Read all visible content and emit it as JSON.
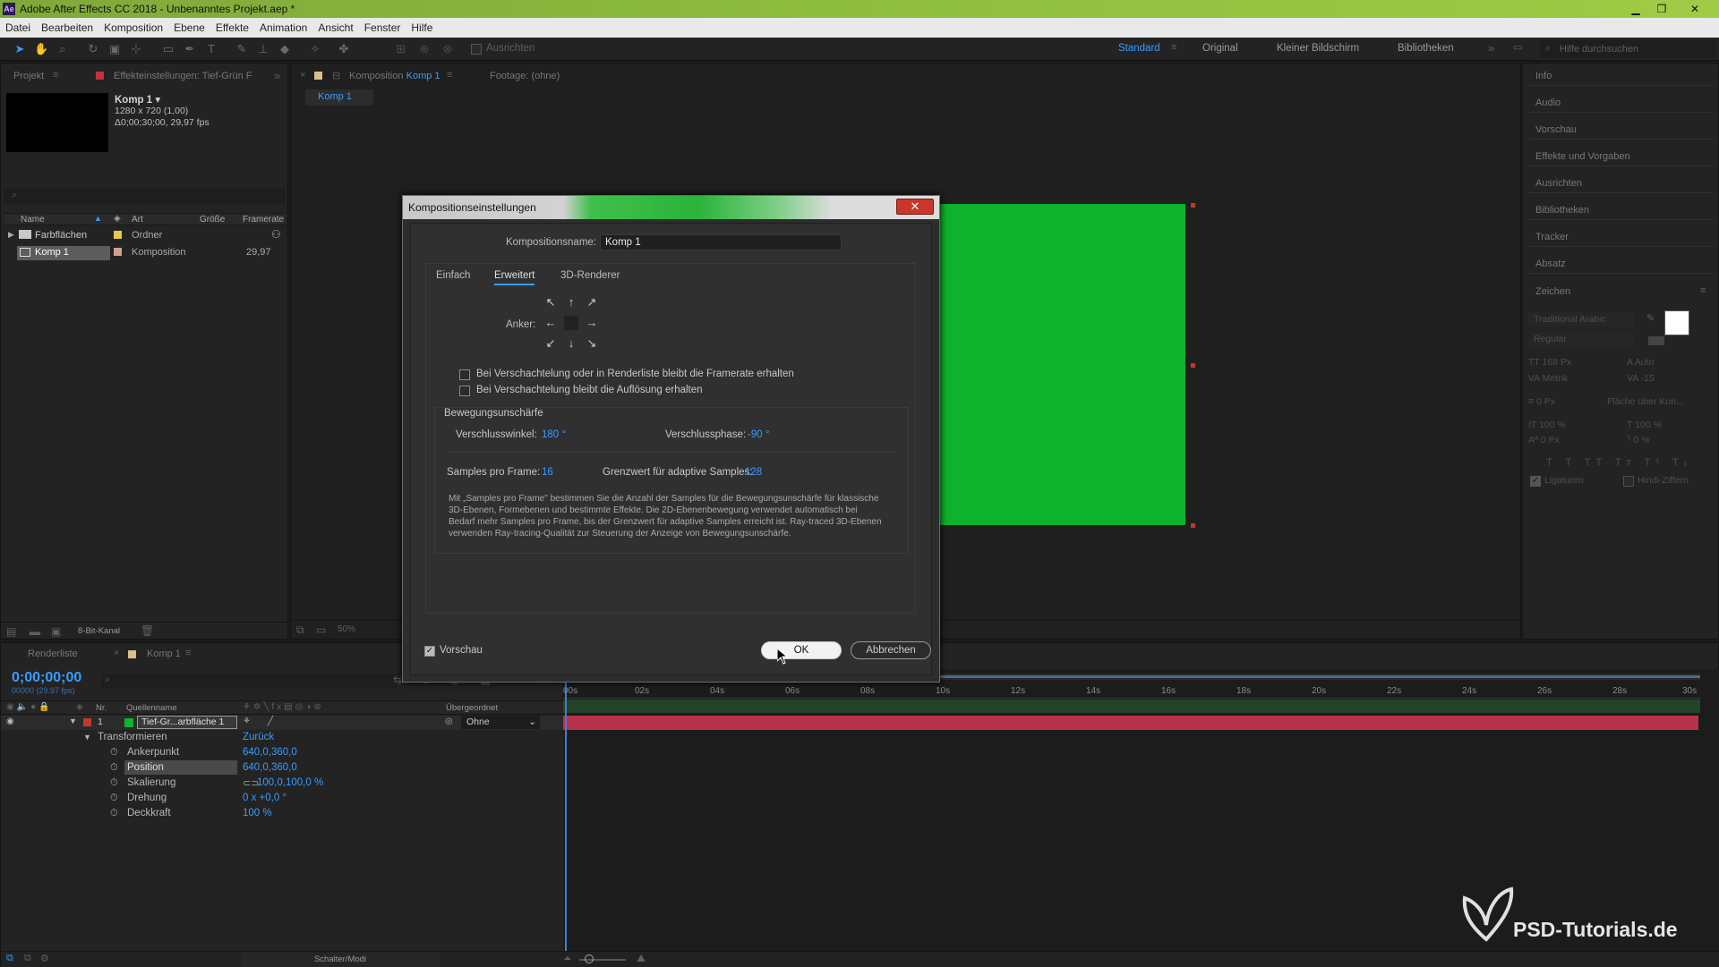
{
  "app": {
    "title": "Adobe After Effects CC 2018 - Unbenanntes Projekt.aep *",
    "logo": "Ae",
    "window_controls": [
      "minimize-icon",
      "restore-icon",
      "close-icon"
    ]
  },
  "menu": [
    "Datei",
    "Bearbeiten",
    "Komposition",
    "Ebene",
    "Effekte",
    "Animation",
    "Ansicht",
    "Fenster",
    "Hilfe"
  ],
  "toolbar": {
    "align_label": "Ausrichten",
    "workspaces": [
      "Standard",
      "Original",
      "Kleiner Bildschirm",
      "Bibliotheken"
    ],
    "active_workspace": "Standard",
    "search_placeholder": "Hilfe durchsuchen"
  },
  "project_panel": {
    "tab": "Projekt",
    "tab2": "Effekteinstellungen: Tief-Grün F",
    "comp_name": "Komp 1",
    "comp_size": "1280 x 720 (1,00)",
    "comp_duration": "Δ0;00;30;00, 29,97 fps",
    "columns": [
      "Name",
      "Art",
      "Größe",
      "Framerate"
    ],
    "rows": [
      {
        "name": "Farbflächen",
        "type": "Ordner",
        "size": "",
        "fps": ""
      },
      {
        "name": "Komp 1",
        "type": "Komposition",
        "size": "",
        "fps": "29,97"
      }
    ],
    "bit_depth": "8-Bit-Kanal"
  },
  "comp_panel": {
    "tab": "Komposition",
    "tab_name": "Komp 1",
    "footage_tab": "Footage: (ohne)",
    "sub_tab": "Komp 1",
    "zoom": "50%",
    "solid_color": "#0db32c"
  },
  "right_panel": {
    "items": [
      "Info",
      "Audio",
      "Vorschau",
      "Effekte und Vorgaben",
      "Ausrichten",
      "Bibliotheken",
      "Tracker",
      "Absatz",
      "Zeichen"
    ],
    "font_name": "Traditional Arabic",
    "font_style": "Regular",
    "font_size": "168 Px",
    "leading": "Auto",
    "kerning": "Metrik",
    "tracking": "-15",
    "stroke_width": "0 Px",
    "stroke_mode": "Fläche über Kon...",
    "vert_scale": "100 %",
    "horiz_scale": "100 %",
    "baseline": "0 Px",
    "tsume": "0 %",
    "ligatures": "Ligaturen",
    "hindi": "Hindi-Ziffern"
  },
  "timeline": {
    "tab_render": "Renderliste",
    "tab_comp": "Komp 1",
    "timecode": "0;00;00;00",
    "timecode_sub": "00000 (29.97 fps)",
    "columns": [
      "Nr.",
      "Quellenname",
      "Übergeordnet"
    ],
    "layer": {
      "num": "1",
      "name": "Tief-Gr...arbfläche 1",
      "parent": "Ohne"
    },
    "transform_label": "Transformieren",
    "reset_label": "Zurück",
    "properties": [
      {
        "name": "Ankerpunkt",
        "value": "640,0,360,0"
      },
      {
        "name": "Position",
        "value": "640,0,360,0"
      },
      {
        "name": "Skalierung",
        "value": "100,0,100,0 %"
      },
      {
        "name": "Drehung",
        "value": "0 x +0,0 °"
      },
      {
        "name": "Deckkraft",
        "value": "100 %"
      }
    ],
    "ruler": [
      "00s",
      "02s",
      "04s",
      "06s",
      "08s",
      "10s",
      "12s",
      "14s",
      "16s",
      "18s",
      "20s",
      "22s",
      "24s",
      "26s",
      "28s",
      "30s"
    ],
    "switches_label": "Schalter/Modi",
    "layer_color": "#b8334a"
  },
  "dialog": {
    "title": "Kompositionseinstellungen",
    "name_label": "Kompositionsname:",
    "name_value": "Komp 1",
    "tabs": [
      "Einfach",
      "Erweitert",
      "3D-Renderer"
    ],
    "active_tab": "Erweitert",
    "anchor_label": "Anker:",
    "check1": "Bei Verschachtelung oder in Renderliste bleibt die Framerate erhalten",
    "check2": "Bei Verschachtelung bleibt die Auflösung erhalten",
    "motion_blur_label": "Bewegungsunschärfe",
    "shutter_angle_label": "Verschlusswinkel:",
    "shutter_angle_value": "180 °",
    "shutter_phase_label": "Verschlussphase:",
    "shutter_phase_value": "-90 °",
    "samples_label": "Samples pro Frame:",
    "samples_value": "16",
    "adaptive_label": "Grenzwert für adaptive Samples:",
    "adaptive_value": "128",
    "description_lines": [
      "Mit „Samples pro Frame\" bestimmen Sie die Anzahl der Samples für die Bewegungsunschärfe für klassische",
      "3D-Ebenen, Formebenen und bestimmte Effekte. Die 2D-Ebenenbewegung verwendet automatisch bei",
      "Bedarf mehr Samples pro Frame, bis der Grenzwert für adaptive Samples erreicht ist. Ray-traced 3D-Ebenen",
      "verwenden Ray-tracing-Qualität zur Steuerung der Anzeige von Bewegungsunschärfe."
    ],
    "preview_label": "Vorschau",
    "ok_label": "OK",
    "cancel_label": "Abbrechen"
  },
  "watermark": "PSD-Tutorials.de"
}
